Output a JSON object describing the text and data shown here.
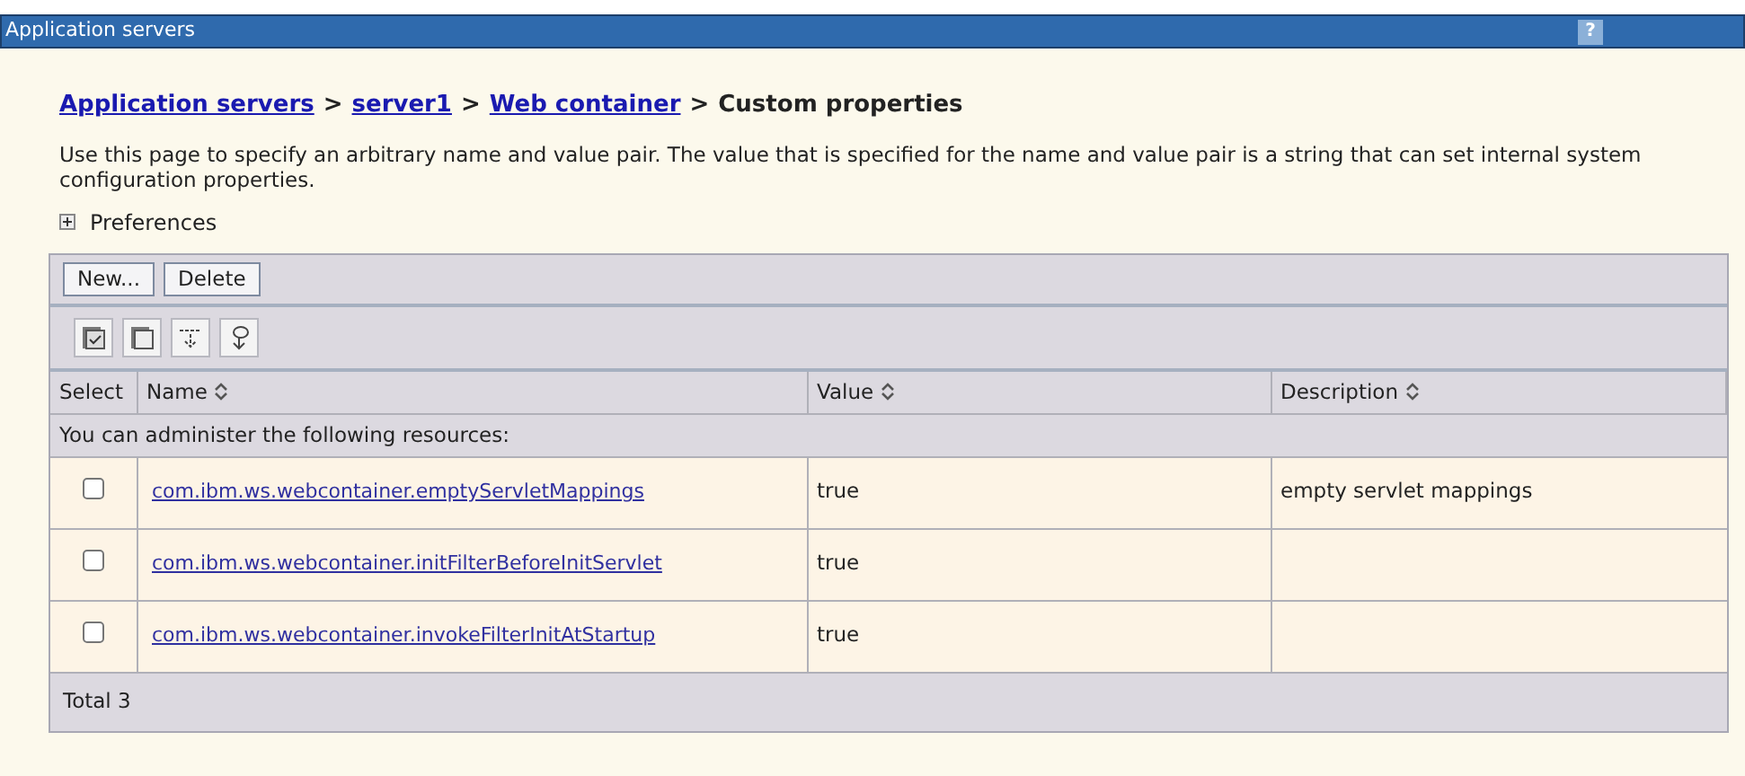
{
  "window": {
    "title": "Application servers",
    "help_button": "?"
  },
  "breadcrumb": [
    {
      "label": "Application servers",
      "link": true
    },
    {
      "label": "server1",
      "link": true
    },
    {
      "label": "Web container",
      "link": true
    },
    {
      "label": "Custom properties",
      "link": false
    }
  ],
  "breadcrumb_separator": ">",
  "description": "Use this page to specify an arbitrary name and value pair. The value that is specified for the name and value pair is a string that can set internal system configuration properties.",
  "preferences": {
    "label": "Preferences",
    "expanded": false
  },
  "buttons": [
    "New...",
    "Delete"
  ],
  "table": {
    "columns": [
      {
        "label": "Select",
        "sortable": false
      },
      {
        "label": "Name",
        "sortable": true
      },
      {
        "label": "Value",
        "sortable": true
      },
      {
        "label": "Description",
        "sortable": true
      }
    ],
    "info": "You can administer the following resources:",
    "rows": [
      {
        "checked": false,
        "name": "com.ibm.ws.webcontainer.emptyServletMappings",
        "value": "true",
        "description": "empty servlet mappings"
      },
      {
        "checked": false,
        "name": "com.ibm.ws.webcontainer.initFilterBeforeInitServlet",
        "value": "true"
      },
      {
        "checked": false,
        "name": "com.ibm.ws.webcontainer.invokeFilterInitAtStartup",
        "value": "true"
      }
    ],
    "total": "Total 3"
  }
}
